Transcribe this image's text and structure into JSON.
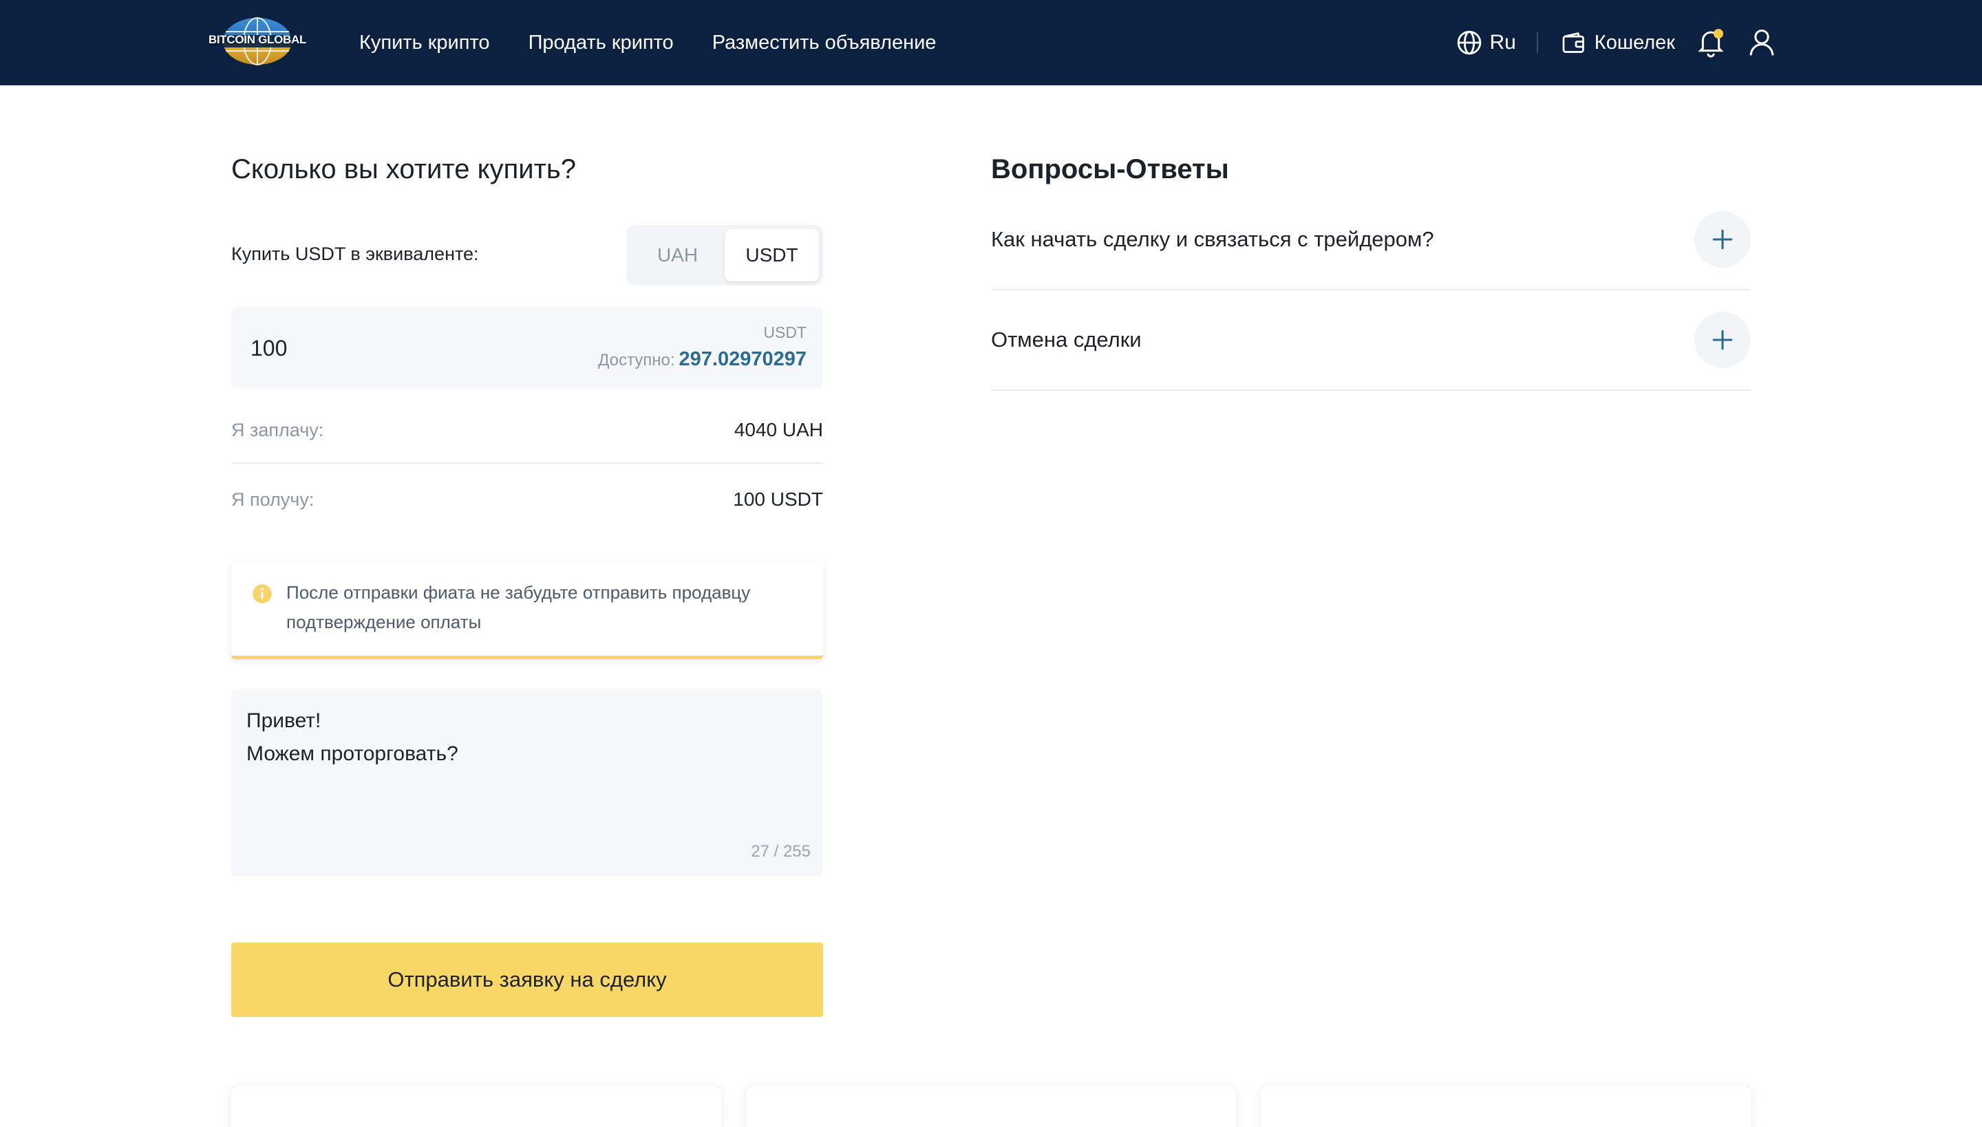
{
  "header": {
    "logo_text": "BITCOIN GLOBAL",
    "nav": [
      "Купить крипто",
      "Продать крипто",
      "Разместить объявление"
    ],
    "language": "Ru",
    "wallet_label": "Кошелек",
    "has_notification": true
  },
  "buy": {
    "title": "Сколько вы хотите купить?",
    "equiv_label": "Купить USDT в эквиваленте:",
    "toggle": {
      "options": [
        "UAH",
        "USDT"
      ],
      "selected": "USDT"
    },
    "amount": {
      "value": "100",
      "currency": "USDT",
      "available_label": "Доступно:",
      "available_value": "297.02970297"
    },
    "pay_label": "Я заплачу:",
    "pay_value": "4040 UAH",
    "receive_label": "Я получу:",
    "receive_value": "100 USDT",
    "notice": "После отправки фиата не забудьте отправить продавцу подтверждение оплаты",
    "message": "Привет!\nМожем проторговать?",
    "message_counter": "27 / 255",
    "submit_label": "Отправить заявку на сделку"
  },
  "faq": {
    "title": "Вопросы-Ответы",
    "items": [
      "Как начать сделку и связаться с трейдером?",
      "Отмена сделки"
    ]
  },
  "colors": {
    "header_bg": "#0c2140",
    "accent_yellow": "#f8d766",
    "link_blue": "#2b6b8f",
    "notification_dot": "#f7c948"
  },
  "icons": [
    "globe-icon",
    "wallet-icon",
    "bell-icon",
    "user-icon",
    "info-icon",
    "plus-icon"
  ]
}
